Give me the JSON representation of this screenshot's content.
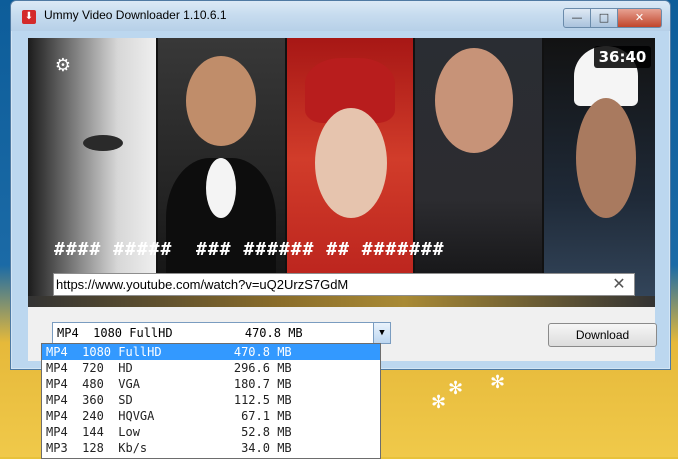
{
  "window": {
    "title": "Ummy Video Downloader 1.10.6.1",
    "controls": {
      "minimize": "—",
      "maximize": "□",
      "close": "✕"
    }
  },
  "video": {
    "duration": "36:40",
    "title": "#### #####  ### ###### ## #######",
    "url": "https://www.youtube.com/watch?v=uQ2UrzS7GdM"
  },
  "format": {
    "selected": "MP4  1080 FullHD          470.8 MB",
    "options": [
      "MP4  1080 FullHD          470.8 MB",
      "MP4  720  HD              296.6 MB",
      "MP4  480  VGA             180.7 MB",
      "MP4  360  SD              112.5 MB",
      "MP4  240  HQVGA            67.1 MB",
      "MP4  144  Low              52.8 MB",
      "MP3  128  Kb/s             34.0 MB"
    ],
    "selected_index": 0
  },
  "actions": {
    "download_label": "Download"
  },
  "icons": {
    "settings": "gear-icon",
    "clear": "close-icon",
    "dropdown": "chevron-down-icon",
    "app": "app-icon"
  },
  "colors": {
    "selected_bg": "#3399ff",
    "title_bar": "#c7dcef",
    "close_button": "#c0452b"
  }
}
